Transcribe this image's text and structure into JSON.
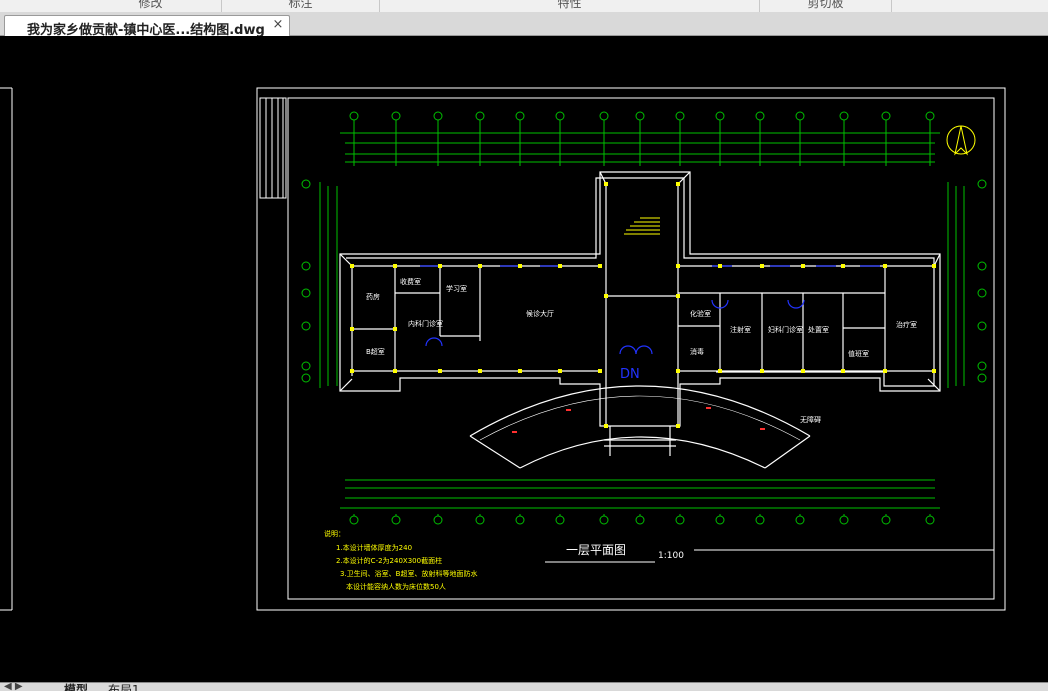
{
  "ribbon": {
    "groups": [
      "修改",
      "标注",
      "特性",
      "剪切板"
    ]
  },
  "document_tab": {
    "title": "我为家乡做贡献-镇中心医...结构图.dwg",
    "close": "×"
  },
  "drawing": {
    "title": "一层平面图",
    "scale": "1:100",
    "rooms": {
      "r1": "药房",
      "r2": "收费室",
      "r3": "学习室",
      "r4": "候诊大厅",
      "r5": "放射科",
      "r6": "内科门诊室",
      "r7": "B超室",
      "r8": "化验室",
      "r9": "消毒",
      "r10": "注射室",
      "r11": "妇科门诊室",
      "r12": "处置室",
      "r13": "治疗室",
      "r14": "值班室"
    },
    "ramp_label": "无障碍",
    "stair_label": "DN",
    "notes": {
      "heading": "说明：",
      "items": [
        "1.本设计墙体厚度为240",
        "2.本设计的C-2为240X300截面柱",
        "3.卫生间、浴室、B超室、放射科等地面防水",
        "本设计能容纳人数为床位数50人"
      ]
    }
  },
  "layouts": {
    "tabs": [
      "模型",
      "布局1"
    ],
    "active": "模型"
  },
  "colors": {
    "canvas_bg": "#000000",
    "frame": "#ffffff",
    "dimension": "#00c000",
    "wall": "#ffffff",
    "column": "#ffff00",
    "window": "#2233ff",
    "accent": "#ff3030"
  }
}
